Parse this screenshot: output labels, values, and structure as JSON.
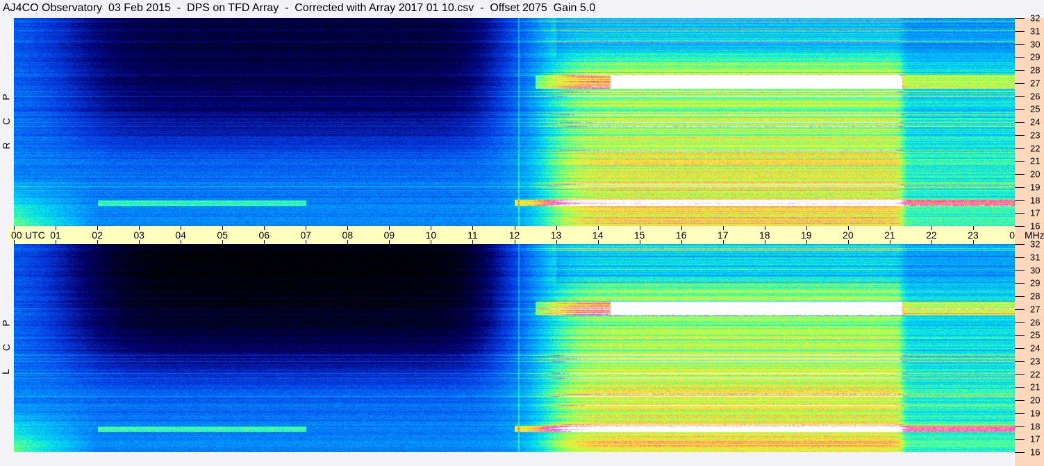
{
  "title": "AJ4CO Observatory  03 Feb 2015  -  DPS on TFD Array  -  Corrected with Array 2017 01 10.csv  -  Offset 2075  Gain 5.0",
  "chart_data": {
    "type": "heatmap",
    "title": "AJ4CO Observatory  03 Feb 2015  -  DPS on TFD Array  -  Corrected with Array 2017 01 10.csv  -  Offset 2075  Gain 5.0",
    "xlabel": "UTC",
    "ylabel": "MHz",
    "xlim": [
      0,
      24
    ],
    "ylim": [
      16,
      32
    ],
    "x_ticks": [
      "00",
      "01",
      "02",
      "03",
      "04",
      "05",
      "06",
      "07",
      "08",
      "09",
      "10",
      "11",
      "12",
      "13",
      "14",
      "15",
      "16",
      "17",
      "18",
      "19",
      "20",
      "21",
      "22",
      "23",
      "00"
    ],
    "y_ticks": [
      "16",
      "17",
      "18",
      "19",
      "20",
      "21",
      "22",
      "23",
      "24",
      "25",
      "26",
      "27",
      "28",
      "29",
      "30",
      "31",
      "32"
    ],
    "panels": [
      {
        "name": "RCP",
        "label_letters": [
          "R",
          "C",
          "P"
        ]
      },
      {
        "name": "LCP",
        "label_letters": [
          "L",
          "C",
          "P"
        ]
      }
    ],
    "features": {
      "night_quiet_utc": [
        0,
        12
      ],
      "day_enhanced_utc": [
        12.2,
        21.3
      ],
      "strong_band_mhz": [
        26.6,
        27.6
      ],
      "strong_band_utc": [
        14.3,
        21.3
      ],
      "secondary_band_mhz": 17.8
    }
  }
}
